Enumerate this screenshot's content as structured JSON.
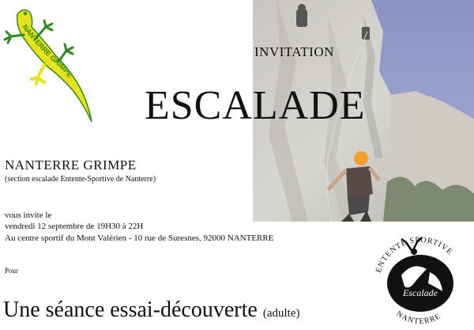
{
  "photo": {
    "description_icon": "climbing-photo"
  },
  "header": {
    "invitation": "INVITATION",
    "title": "ESCALADE"
  },
  "club": {
    "name": "NANTERRE  GRIMPE",
    "section": "(section escalade Entente-Sportive de Nanterre)"
  },
  "details": {
    "invites": "vous invite le",
    "date": "vendredi 12 septembre de 19H30 à 22H",
    "address": "Au centre sportif du Mont Valérien - 10 rue de Suresnes, 92000 NANTERRE"
  },
  "purpose": {
    "pour": "Pour",
    "seance": "Une séance essai-découverte",
    "seance_small": "(adulte)"
  },
  "logo_gecko": {
    "text": "NANTERRE GRIMPE"
  },
  "logo_badge": {
    "top_text": "ENTENTE SPORTIVE",
    "middle_text": "Escalade",
    "bottom_text": "NANTERRE"
  },
  "colors": {
    "gecko_yellow": "#e8e21a",
    "gecko_green": "#2f8a1f",
    "badge_black": "#111111"
  }
}
